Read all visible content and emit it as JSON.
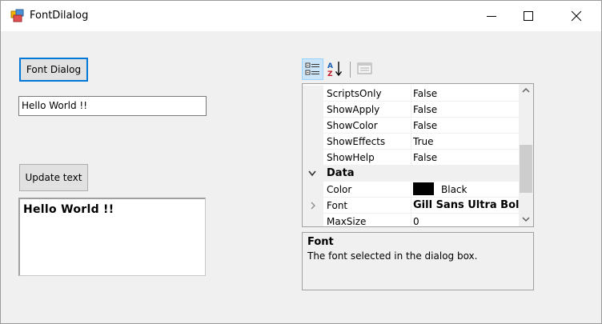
{
  "window": {
    "title": "FontDilalog"
  },
  "form": {
    "font_dialog_button": "Font Dialog",
    "text_input_value": "Hello World !!",
    "update_button": "Update text",
    "rich_text_value": "Hello World !!"
  },
  "property_grid": {
    "rows": [
      {
        "name": "ScriptsOnly",
        "value": "False"
      },
      {
        "name": "ShowApply",
        "value": "False"
      },
      {
        "name": "ShowColor",
        "value": "False"
      },
      {
        "name": "ShowEffects",
        "value": "True"
      },
      {
        "name": "ShowHelp",
        "value": "False"
      }
    ],
    "category": "Data",
    "data_rows": [
      {
        "name": "Color",
        "value": "Black"
      },
      {
        "name": "Font",
        "value": "Gill Sans Ultra Bold"
      },
      {
        "name": "MaxSize",
        "value": "0"
      }
    ],
    "description_title": "Font",
    "description_text": "The font selected in the dialog box."
  },
  "colors": {
    "accent": "#0078d7",
    "color_swatch": "#000000"
  }
}
